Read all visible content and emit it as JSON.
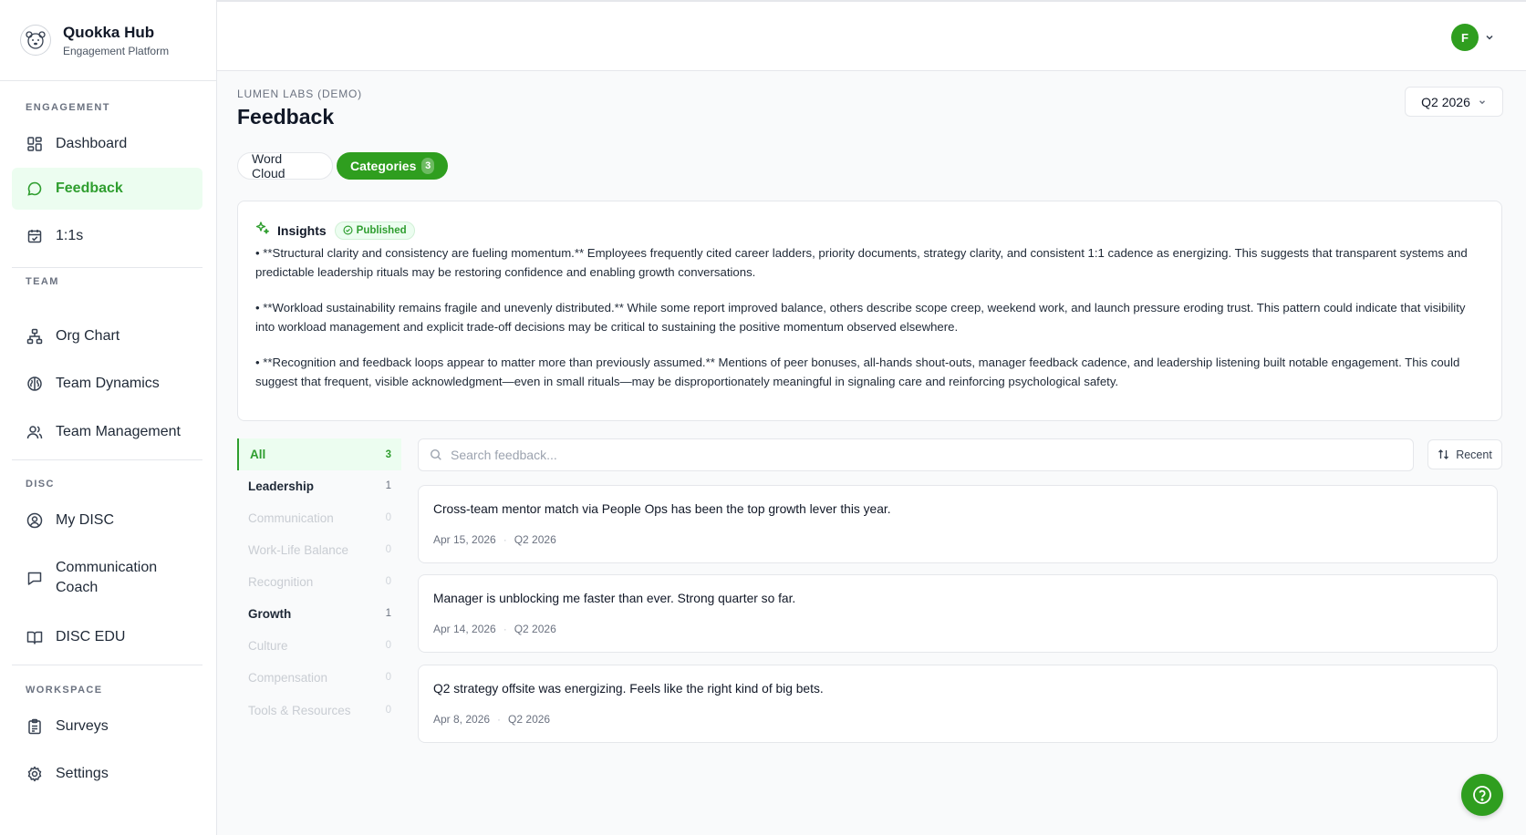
{
  "brand": {
    "title": "Quokka Hub",
    "subtitle": "Engagement Platform"
  },
  "sidebar": {
    "sections": [
      {
        "label": "ENGAGEMENT",
        "items": [
          {
            "label": "Dashboard",
            "icon": "dashboard-grid-icon"
          },
          {
            "label": "Feedback",
            "icon": "chat-bubble-icon",
            "active": true
          },
          {
            "label": "1:1s",
            "icon": "calendar-check-icon"
          }
        ]
      },
      {
        "label": "TEAM",
        "items": [
          {
            "label": "Org Chart",
            "icon": "org-chart-icon"
          },
          {
            "label": "Team Dynamics",
            "icon": "brain-icon"
          },
          {
            "label": "Team Management",
            "icon": "users-icon"
          }
        ]
      },
      {
        "label": "DISC",
        "items": [
          {
            "label": "My DISC",
            "icon": "user-circle-icon"
          },
          {
            "label": "Communication Coach",
            "icon": "message-square-icon"
          },
          {
            "label": "DISC EDU",
            "icon": "book-open-icon"
          }
        ]
      },
      {
        "label": "WORKSPACE",
        "items": [
          {
            "label": "Surveys",
            "icon": "clipboard-list-icon"
          },
          {
            "label": "Settings",
            "icon": "gear-icon"
          }
        ]
      }
    ]
  },
  "header": {
    "avatar_initial": "F"
  },
  "page": {
    "org": "LUMEN LABS (DEMO)",
    "title": "Feedback",
    "period": "Q2 2026",
    "tabs": [
      {
        "label": "Word Cloud"
      },
      {
        "label": "Categories",
        "count": "3",
        "active": true
      }
    ]
  },
  "insights": {
    "title": "Insights",
    "badge": "Published",
    "paragraphs": [
      "• **Structural clarity and consistency are fueling momentum.** Employees frequently cited career ladders, priority documents, strategy clarity, and consistent 1:1 cadence as energizing. This suggests that transparent systems and predictable leadership rituals may be restoring confidence and enabling growth conversations.",
      "• **Workload sustainability remains fragile and unevenly distributed.** While some report improved balance, others describe scope creep, weekend work, and launch pressure eroding trust. This pattern could indicate that visibility into workload management and explicit trade-off decisions may be critical to sustaining the positive momentum observed elsewhere.",
      "• **Recognition and feedback loops appear to matter more than previously assumed.** Mentions of peer bonuses, all-hands shout-outs, manager feedback cadence, and leadership listening built notable engagement. This could suggest that frequent, visible acknowledgment—even in small rituals—may be disproportionately meaningful in signaling care and reinforcing psychological safety."
    ]
  },
  "categories": [
    {
      "label": "All",
      "count": "3"
    },
    {
      "label": "Leadership",
      "count": "1"
    },
    {
      "label": "Communication",
      "count": "0"
    },
    {
      "label": "Work-Life Balance",
      "count": "0"
    },
    {
      "label": "Recognition",
      "count": "0"
    },
    {
      "label": "Growth",
      "count": "1"
    },
    {
      "label": "Culture",
      "count": "0"
    },
    {
      "label": "Compensation",
      "count": "0"
    },
    {
      "label": "Tools & Resources",
      "count": "0"
    }
  ],
  "search": {
    "placeholder": "Search feedback...",
    "value": ""
  },
  "sort": {
    "label": "Recent"
  },
  "feedback": [
    {
      "text": "Cross-team mentor match via People Ops has been the top growth lever this year.",
      "date": "Apr 15, 2026",
      "period": "Q2 2026"
    },
    {
      "text": "Manager is unblocking me faster than ever. Strong quarter so far.",
      "date": "Apr 14, 2026",
      "period": "Q2 2026"
    },
    {
      "text": "Q2 strategy offsite was energizing. Feels like the right kind of big bets.",
      "date": "Apr 8, 2026",
      "period": "Q2 2026"
    }
  ],
  "colors": {
    "accent": "#2f9e1f",
    "accent_light": "#ecfdf0",
    "border": "#e5e7eb",
    "background": "#f9fafb"
  }
}
